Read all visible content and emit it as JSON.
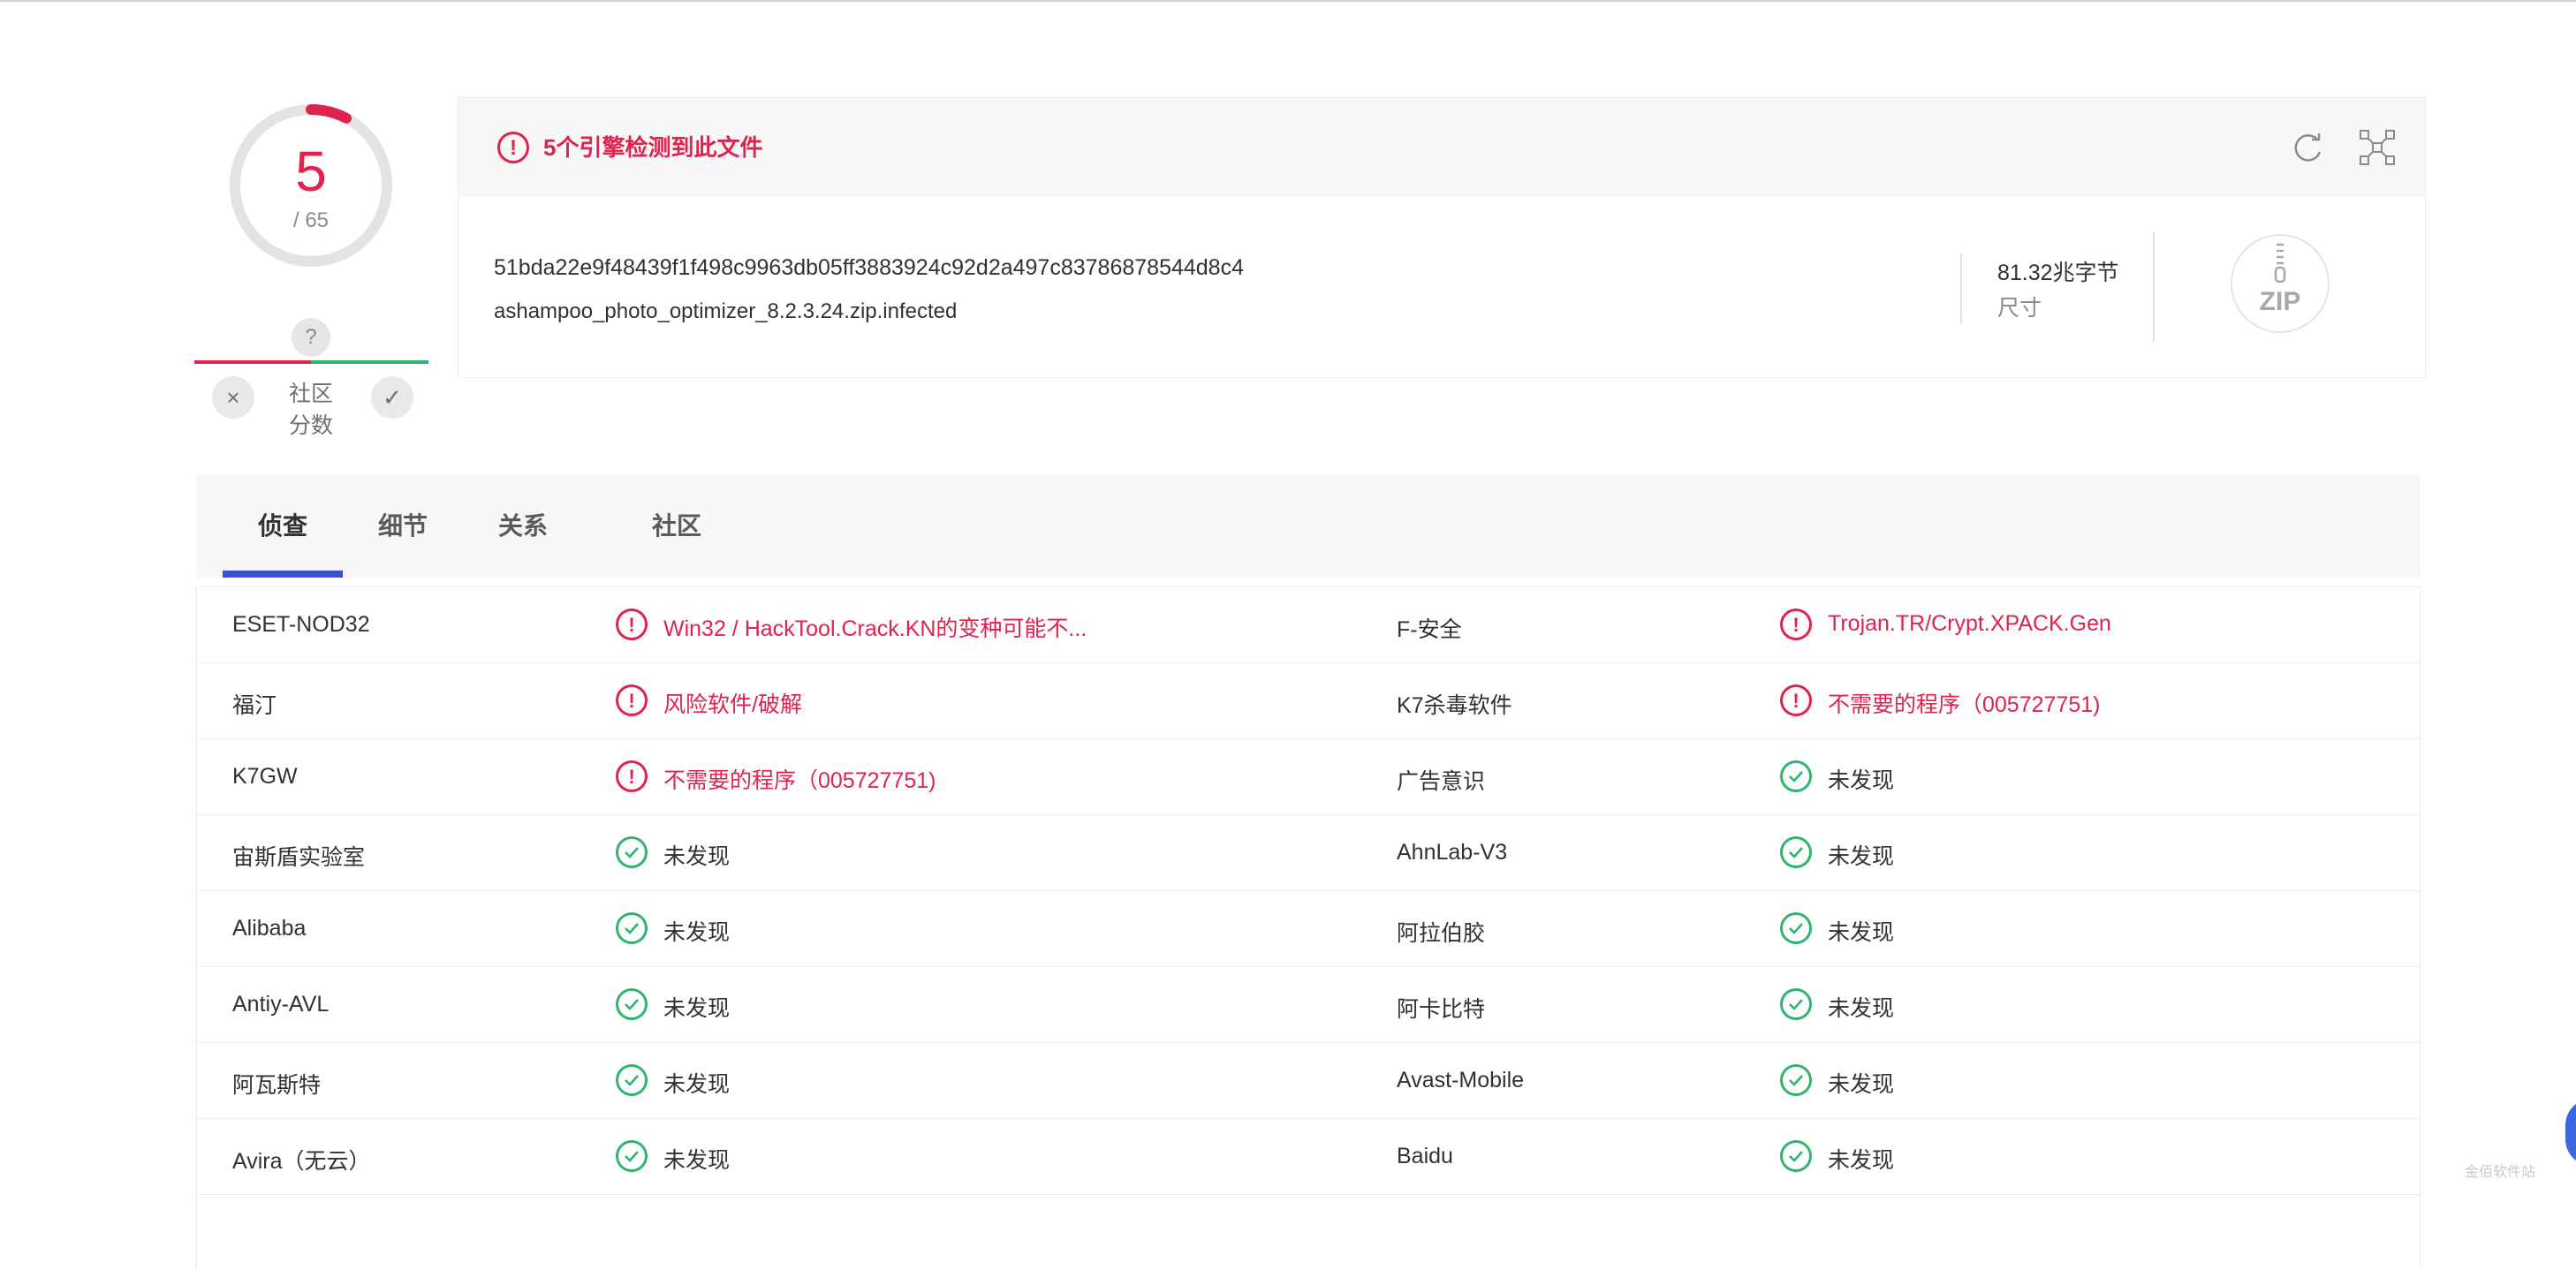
{
  "score": {
    "detected": "5",
    "total": "/ 65",
    "detected_fraction": 0.077,
    "ring_color": "#e0224e"
  },
  "community": {
    "badge": "?",
    "label_line1": "社区",
    "label_line2": "分数",
    "down_icon": "×",
    "up_icon": "✓",
    "negative_color": "#e0224e",
    "positive_color": "#2fb46e"
  },
  "summary": {
    "alert_text": "5个引擎检测到此文件",
    "alert_icon": "!",
    "hash": "51bda22e9f48439f1f498c9963db05ff3883924c92d2a497c83786878544d8c4",
    "file_name": "ashampoo_photo_optimizer_8.2.3.24.zip.infected",
    "size_value": "81.32兆字节",
    "size_label": "尺寸",
    "file_type": "ZIP"
  },
  "tabs": [
    "侦查",
    "细节",
    "关系",
    "社区"
  ],
  "active_tab": "侦查",
  "accent_color": "#3c4fd1",
  "detections": [
    {
      "left": {
        "engine": "ESET-NOD32",
        "status": "bad",
        "result": "Win32 / HackTool.Crack.KN的变种可能不..."
      },
      "right": {
        "engine": "F-安全",
        "status": "bad",
        "result": "Trojan.TR/Crypt.XPACK.Gen"
      }
    },
    {
      "left": {
        "engine": "福汀",
        "status": "bad",
        "result": "风险软件/破解"
      },
      "right": {
        "engine": "K7杀毒软件",
        "status": "bad",
        "result": "不需要的程序（005727751)"
      }
    },
    {
      "left": {
        "engine": "K7GW",
        "status": "bad",
        "result": "不需要的程序（005727751)"
      },
      "right": {
        "engine": "广告意识",
        "status": "ok",
        "result": "未发现"
      }
    },
    {
      "left": {
        "engine": "宙斯盾实验室",
        "status": "ok",
        "result": "未发现"
      },
      "right": {
        "engine": "AhnLab-V3",
        "status": "ok",
        "result": "未发现"
      }
    },
    {
      "left": {
        "engine": "Alibaba",
        "status": "ok",
        "result": "未发现"
      },
      "right": {
        "engine": "阿拉伯胶",
        "status": "ok",
        "result": "未发现"
      }
    },
    {
      "left": {
        "engine": "Antiy-AVL",
        "status": "ok",
        "result": "未发现"
      },
      "right": {
        "engine": "阿卡比特",
        "status": "ok",
        "result": "未发现"
      }
    },
    {
      "left": {
        "engine": "阿瓦斯特",
        "status": "ok",
        "result": "未发现"
      },
      "right": {
        "engine": "Avast-Mobile",
        "status": "ok",
        "result": "未发现"
      }
    },
    {
      "left": {
        "engine": "Avira（无云）",
        "status": "ok",
        "result": "未发现"
      },
      "right": {
        "engine": "Baidu",
        "status": "ok",
        "result": "未发现"
      }
    },
    {
      "left": {
        "engine": "",
        "status": "",
        "result": ""
      },
      "right": {
        "engine": "",
        "status": "",
        "result": ""
      }
    }
  ],
  "watermark": "金佰软件站"
}
